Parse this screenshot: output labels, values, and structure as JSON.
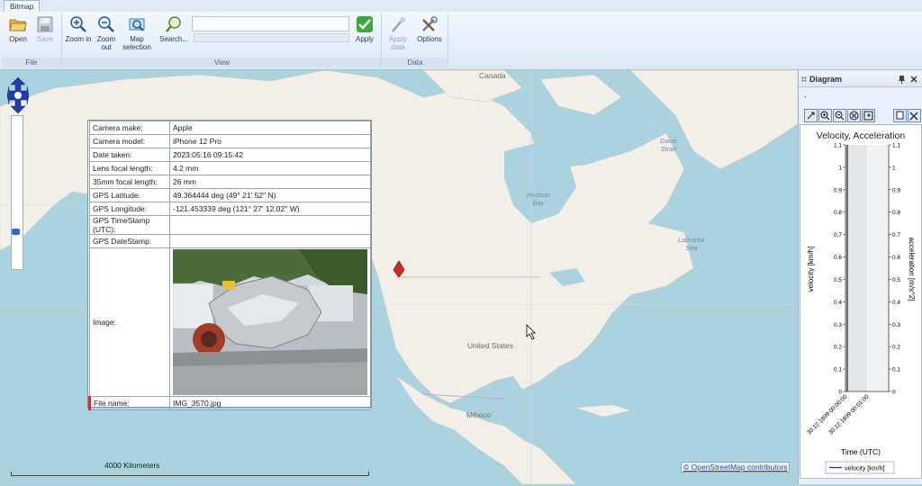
{
  "ribbon": {
    "tab": "Bitmap",
    "file_group": {
      "label": "File",
      "open": "Open",
      "save": "Save"
    },
    "view_group": {
      "label": "View",
      "zoom_in": "Zoom in",
      "zoom_out": "Zoom out",
      "map_selection": "Map selection",
      "search": "Search...",
      "apply": "Apply"
    },
    "data_group": {
      "label": "Data",
      "apply_data": "Apply data",
      "options": "Options"
    }
  },
  "map": {
    "labels": {
      "canada": "Canada",
      "united_states": "United States",
      "mexico": "México",
      "hudson_bay": "Hudson\nBay",
      "davis_strait": "Davis\nStrait",
      "labrador_sea": "Labrador\nSea"
    },
    "scale": "4000 Kilometers",
    "credit": "© OpenStreetMap contributors"
  },
  "info": {
    "rows": [
      {
        "k": "Camera make:",
        "v": "Apple"
      },
      {
        "k": "Camera model:",
        "v": "iPhone 12 Pro"
      },
      {
        "k": "Date taken:",
        "v": "2023:05:16 09:15:42"
      },
      {
        "k": "Lens focal length:",
        "v": "4.2 mm"
      },
      {
        "k": "35mm focal length:",
        "v": "26 mm"
      },
      {
        "k": "GPS Latitude:",
        "v": "49.364444 deg (49° 21' 52'' N)"
      },
      {
        "k": "GPS Longitude:",
        "v": "-121.453339 deg (121° 27' 12.02'' W)"
      },
      {
        "k": "GPS TimeStamp (UTC):",
        "v": ""
      },
      {
        "k": "GPS DateStamp:",
        "v": ""
      }
    ],
    "image_label": "Image:",
    "file_label": "File name:",
    "file_value": "IMG_3570.jpg"
  },
  "diagram": {
    "title": "Diagram",
    "dot": "."
  },
  "chart_data": {
    "type": "line",
    "title": "Velocity, Acceleration",
    "xlabel": "Time (UTC)",
    "ylabel": "velocity [km/h]",
    "y2label": "acceleration [m/s^2]",
    "yticks": [
      "0",
      "0.1",
      "0.2",
      "0.3",
      "0.4",
      "0.5",
      "0.6",
      "0.7",
      "0.8",
      "0.9",
      "1",
      "1.1"
    ],
    "ylim": [
      0,
      1.1
    ],
    "xticks": [
      "30.12.1899 00:00:00",
      "30.12.1899 00:01:00"
    ],
    "series": [
      {
        "name": "velocity [km/h]",
        "values": []
      }
    ]
  }
}
